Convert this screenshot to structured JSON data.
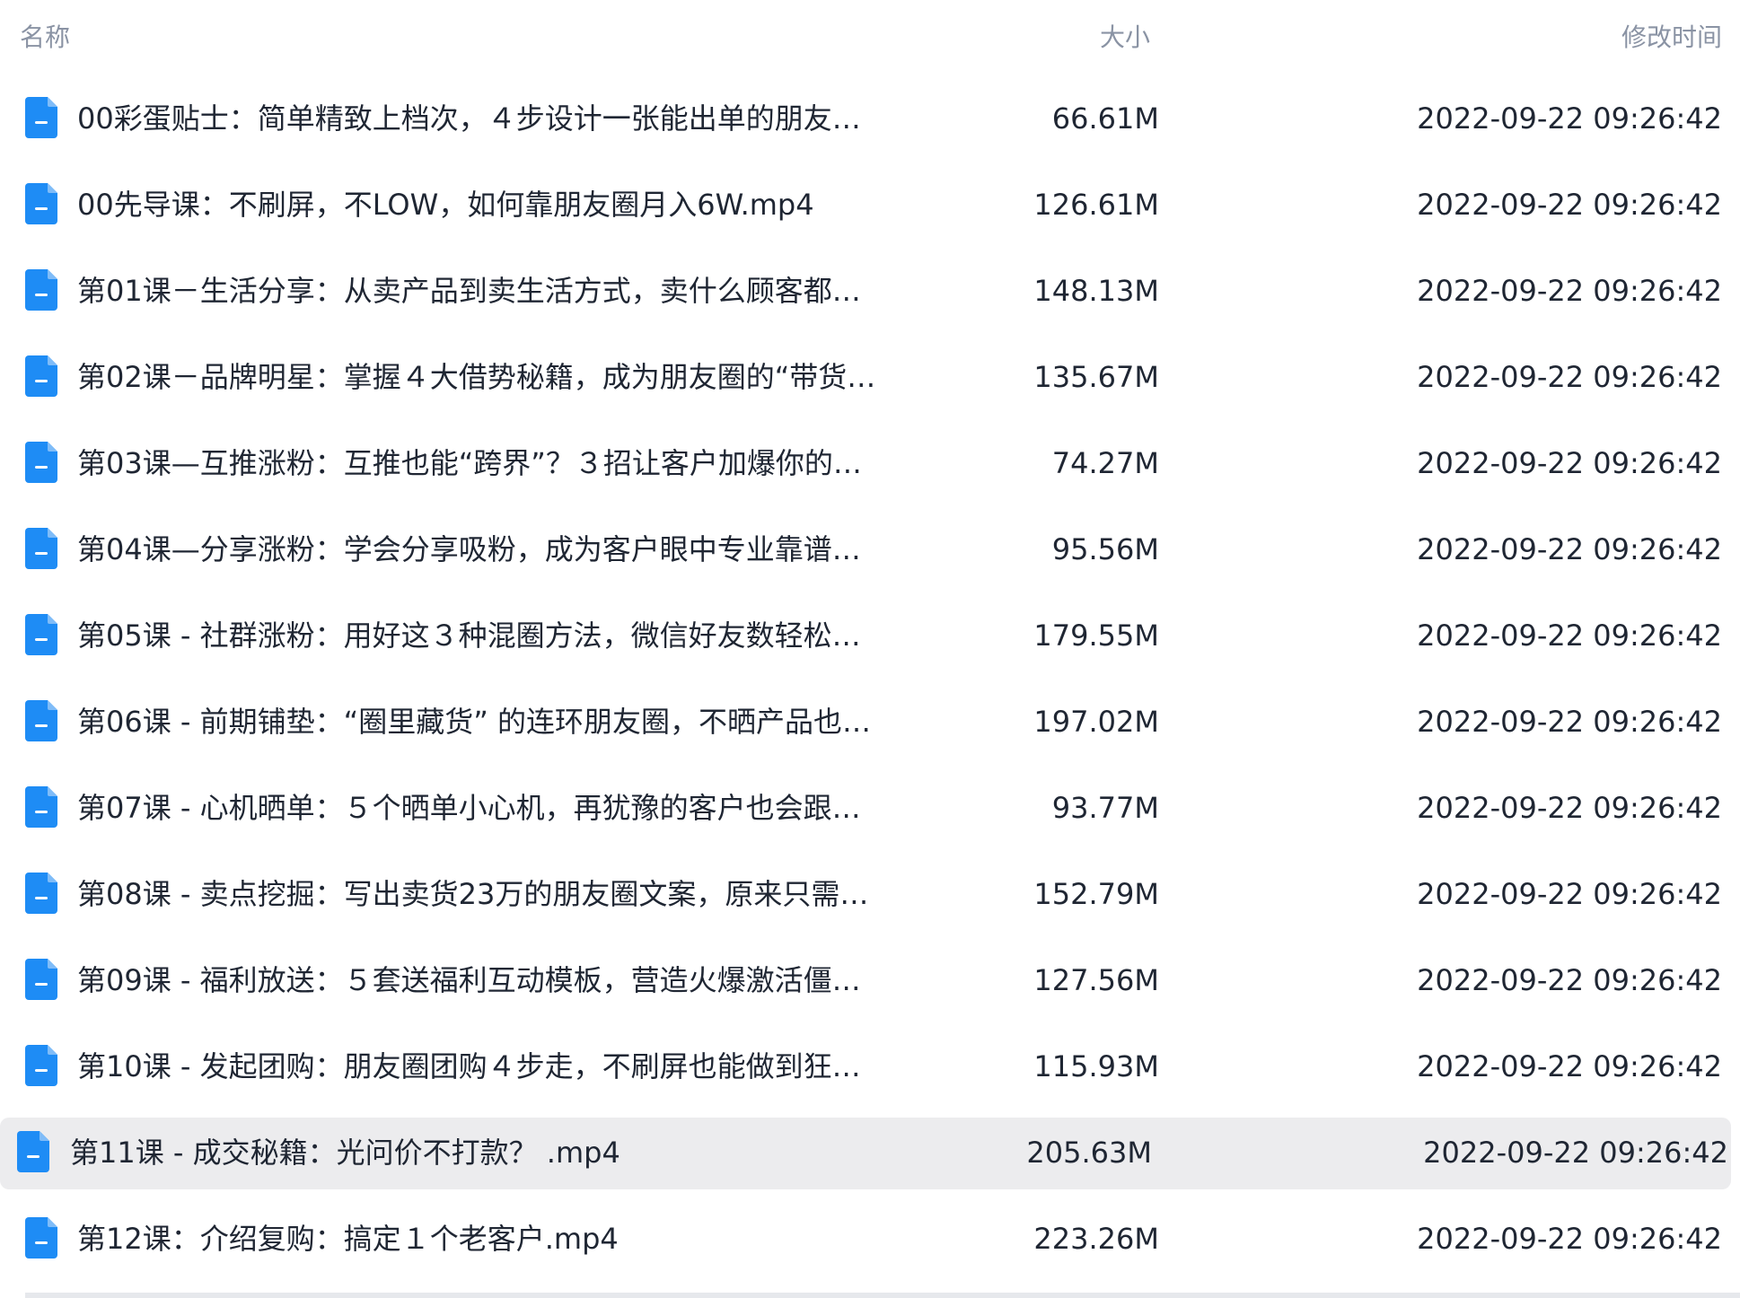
{
  "header": {
    "name_label": "名称",
    "size_label": "大小",
    "time_label": "修改时间"
  },
  "colors": {
    "icon_blue": "#1e8cf5",
    "selected_row_bg": "#ececee",
    "header_text": "#8a93a4",
    "row_text": "#1f2633"
  },
  "icon": "document-file-icon",
  "selected_index": 12,
  "files": [
    {
      "name": "00彩蛋贴士：简单精致上档次，４步设计一张能出单的朋友…",
      "size": "66.61M",
      "time": "2022-09-22 09:26:42"
    },
    {
      "name": "00先导课：不刷屏，不LOW，如何靠朋友圈月入6W.mp4",
      "size": "126.61M",
      "time": "2022-09-22 09:26:42"
    },
    {
      "name": "第01课－生活分享：从卖产品到卖生活方式，卖什么顾客都…",
      "size": "148.13M",
      "time": "2022-09-22 09:26:42"
    },
    {
      "name": "第02课－品牌明星：掌握４大借势秘籍，成为朋友圈的“带货…",
      "size": "135.67M",
      "time": "2022-09-22 09:26:42"
    },
    {
      "name": "第03课—互推涨粉：互推也能“跨界”？３招让客户加爆你的…",
      "size": "74.27M",
      "time": "2022-09-22 09:26:42"
    },
    {
      "name": "第04课—分享涨粉：学会分享吸粉，成为客户眼中专业靠谱…",
      "size": "95.56M",
      "time": "2022-09-22 09:26:42"
    },
    {
      "name": "第05课 - 社群涨粉：用好这３种混圈方法，微信好友数轻松…",
      "size": "179.55M",
      "time": "2022-09-22 09:26:42"
    },
    {
      "name": "第06课 - 前期铺垫：“圈里藏货” 的连环朋友圈，不晒产品也…",
      "size": "197.02M",
      "time": "2022-09-22 09:26:42"
    },
    {
      "name": "第07课 - 心机晒单：５个晒单小心机，再犹豫的客户也会跟…",
      "size": "93.77M",
      "time": "2022-09-22 09:26:42"
    },
    {
      "name": "第08课 - 卖点挖掘：写出卖货23万的朋友圈文案，原来只需…",
      "size": "152.79M",
      "time": "2022-09-22 09:26:42"
    },
    {
      "name": "第09课 - 福利放送：５套送福利互动模板，营造火爆激活僵…",
      "size": "127.56M",
      "time": "2022-09-22 09:26:42"
    },
    {
      "name": "第10课 - 发起团购：朋友圈团购４步走，不刷屏也能做到狂…",
      "size": "115.93M",
      "time": "2022-09-22 09:26:42"
    },
    {
      "name": "第11课 - 成交秘籍：光问价不打款？ .mp4",
      "size": "205.63M",
      "time": "2022-09-22 09:26:42"
    },
    {
      "name": "第12课：介绍复购：搞定１个老客户.mp4",
      "size": "223.26M",
      "time": "2022-09-22 09:26:42"
    }
  ]
}
